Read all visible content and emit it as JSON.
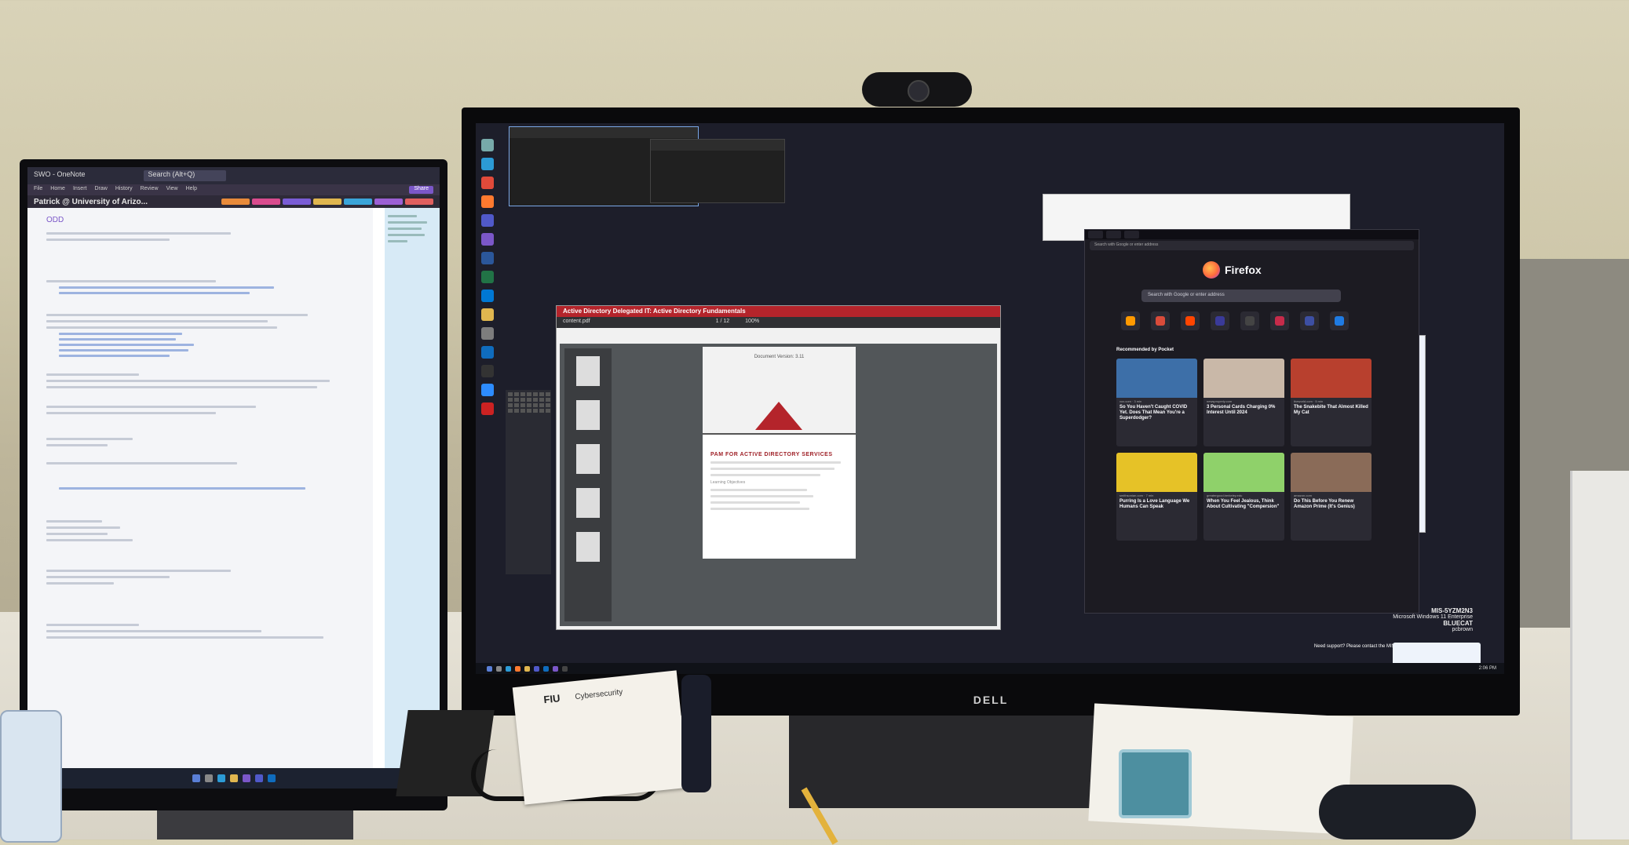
{
  "left_monitor": {
    "app": "OneNote",
    "window_title": "SWO - OneNote",
    "search_placeholder": "Search (Alt+Q)",
    "menus": [
      "File",
      "Home",
      "Insert",
      "Draw",
      "History",
      "Review",
      "View",
      "Help"
    ],
    "page_header": "Patrick @ University of Arizo...",
    "share_label": "Share",
    "page_title": "ODD",
    "section_colors": [
      "#e88a3a",
      "#d94b8e",
      "#7a5cd6",
      "#e0b64f",
      "#3aa4d9",
      "#9b5fd4",
      "#e05f5f"
    ]
  },
  "main_monitor": {
    "brand": "DELL",
    "pdf_window": {
      "course_bar": "Active Directory Delegated IT: Active Directory Fundamentals",
      "filename": "content.pdf",
      "page_counter": "1 / 12",
      "zoom": "100%",
      "doc_version": "Document Version: 3.11",
      "doc_title": "PAM FOR ACTIVE DIRECTORY SERVICES",
      "section": "Learning Objectives"
    },
    "firefox": {
      "brand": "Firefox",
      "search_placeholder": "Search with Google or enter address",
      "url_placeholder": "Search with Google or enter address",
      "recommended_heading": "Recommended by Pocket",
      "cards": [
        {
          "source": "vox.com · 3 min",
          "title": "So You Haven't Caught COVID Yet. Does That Mean You're a Superdodger?",
          "color": "#3d6fa8"
        },
        {
          "source": "newsproperly.com",
          "title": "3 Personal Cards Charging 0% Interest Until 2024",
          "color": "#c9b8a8"
        },
        {
          "source": "theworld.com · 5 min",
          "title": "The Snakebite That Almost Killed My Cat",
          "color": "#b8402e"
        },
        {
          "source": "smithsonian.com · 7 min",
          "title": "Purring Is a Love Language We Humans Can Speak",
          "color": "#e6c227"
        },
        {
          "source": "greatergood.berkeley.edu",
          "title": "When You Feel Jealous, Think About Cultivating \"Compersion\"",
          "color": "#8fd16a"
        },
        {
          "source": "amazon.com",
          "title": "Do This Before You Renew Amazon Prime (It's Genius)",
          "color": "#8a6b58"
        }
      ]
    },
    "system_info": {
      "hostname": "MIS-5YZM2N3",
      "os": "Microsoft Windows 11 Enterprise",
      "domain": "BLUECAT",
      "user": "pcbrown",
      "support_text": "Need support? Please contact the MIS Help Desk"
    },
    "taskbar": {
      "time": "2:06 PM"
    }
  },
  "desk": {
    "notebook_brand": "FIU",
    "notebook_label": "Cybersecurity"
  }
}
